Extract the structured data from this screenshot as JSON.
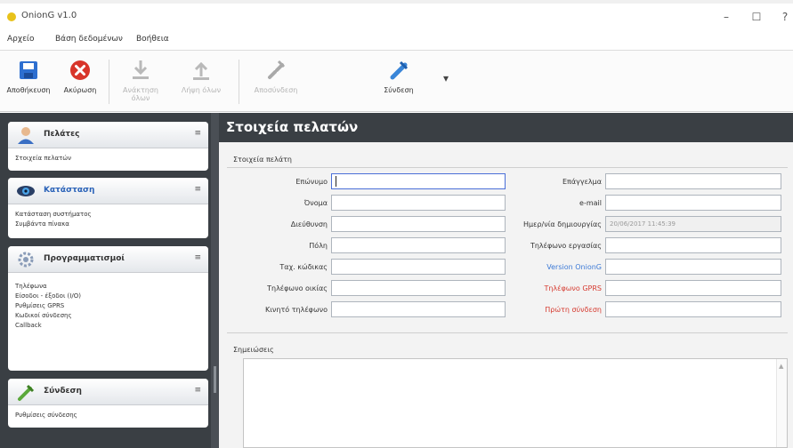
{
  "window": {
    "title": "OnionG v1.0",
    "minimize": "–",
    "maximize": "☐",
    "close": "?"
  },
  "menu": [
    "Αρχείο",
    "Βάση δεδομένων",
    "Βοήθεια"
  ],
  "toolbar": {
    "save": "Αποθήκευση",
    "cancel": "Ακύρωση",
    "import_line1": "Ανάκτηση",
    "import_line2": "όλων",
    "export": "Λήψη όλων",
    "disconnect": "Αποσύνδεση",
    "connect": "Σύνδεση",
    "more": "▾"
  },
  "sidebar": {
    "panels": [
      {
        "title": "Πελάτες",
        "items": [
          "Στοιχεία πελατών"
        ]
      },
      {
        "title": "Κατάσταση",
        "items": [
          "Κατάσταση συστήματος",
          "Συμβάντα πίνακα"
        ]
      },
      {
        "title": "Προγραμματισμοί",
        "items": [
          "Τηλέφωνα",
          "Είσοδοι - έξοδοι (I/O)",
          "Ρυθμίσεις GPRS",
          "Κωδικοί σύνδεσης",
          "Callback"
        ]
      },
      {
        "title": "Σύνδεση",
        "items": [
          "Ρυθμίσεις σύνδεσης"
        ]
      }
    ],
    "chevron": "≡"
  },
  "main": {
    "header": "Στοιχεία πελατών",
    "group_client": "Στοιχεία πελάτη",
    "group_notes": "Σημειώσεις",
    "left_fields": [
      {
        "label": "Επώνυμο",
        "value": ""
      },
      {
        "label": "Όνομα",
        "value": ""
      },
      {
        "label": "Διεύθυνση",
        "value": ""
      },
      {
        "label": "Πόλη",
        "value": ""
      },
      {
        "label": "Ταχ. κώδικας",
        "value": ""
      },
      {
        "label": "Τηλέφωνο οικίας",
        "value": ""
      },
      {
        "label": "Κινητό τηλέφωνο",
        "value": ""
      }
    ],
    "right_fields": [
      {
        "label": "Επάγγελμα",
        "value": ""
      },
      {
        "label": "e-mail",
        "value": ""
      },
      {
        "label": "Ημερ/νία δημιουργίας",
        "value": "20/06/2017 11:45:39"
      },
      {
        "label": "Τηλέφωνο εργασίας",
        "value": ""
      },
      {
        "label": "Version OnionG",
        "value": ""
      },
      {
        "label": "Τηλέφωνο GPRS",
        "value": ""
      },
      {
        "label": "Πρώτη σύνδεση",
        "value": ""
      }
    ],
    "notes_value": ""
  },
  "colors": {
    "dark": "#3a3f44",
    "accent_blue": "#3d7ad6",
    "accent_red": "#d63b30"
  }
}
